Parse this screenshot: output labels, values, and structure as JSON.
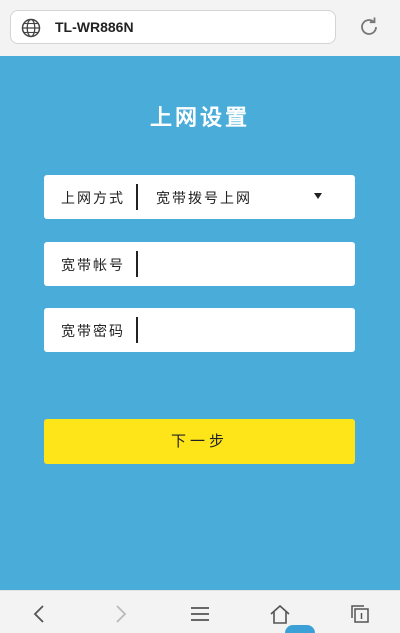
{
  "browser": {
    "url_text": "TL-WR886N",
    "globe_icon": "globe-icon",
    "reload_icon": "reload-icon"
  },
  "page": {
    "title": "上网设置",
    "background_color": "#4aadd9"
  },
  "form": {
    "connection_type": {
      "label": "上网方式",
      "selected": "宽带拨号上网"
    },
    "account": {
      "label": "宽带帐号",
      "value": ""
    },
    "password": {
      "label": "宽带密码",
      "value": ""
    },
    "next_button": {
      "label": "下一步",
      "color": "#fde51a"
    }
  },
  "bottom_nav": {
    "items": [
      "back-icon",
      "forward-icon",
      "menu-icon",
      "home-icon",
      "tabs-icon"
    ]
  }
}
